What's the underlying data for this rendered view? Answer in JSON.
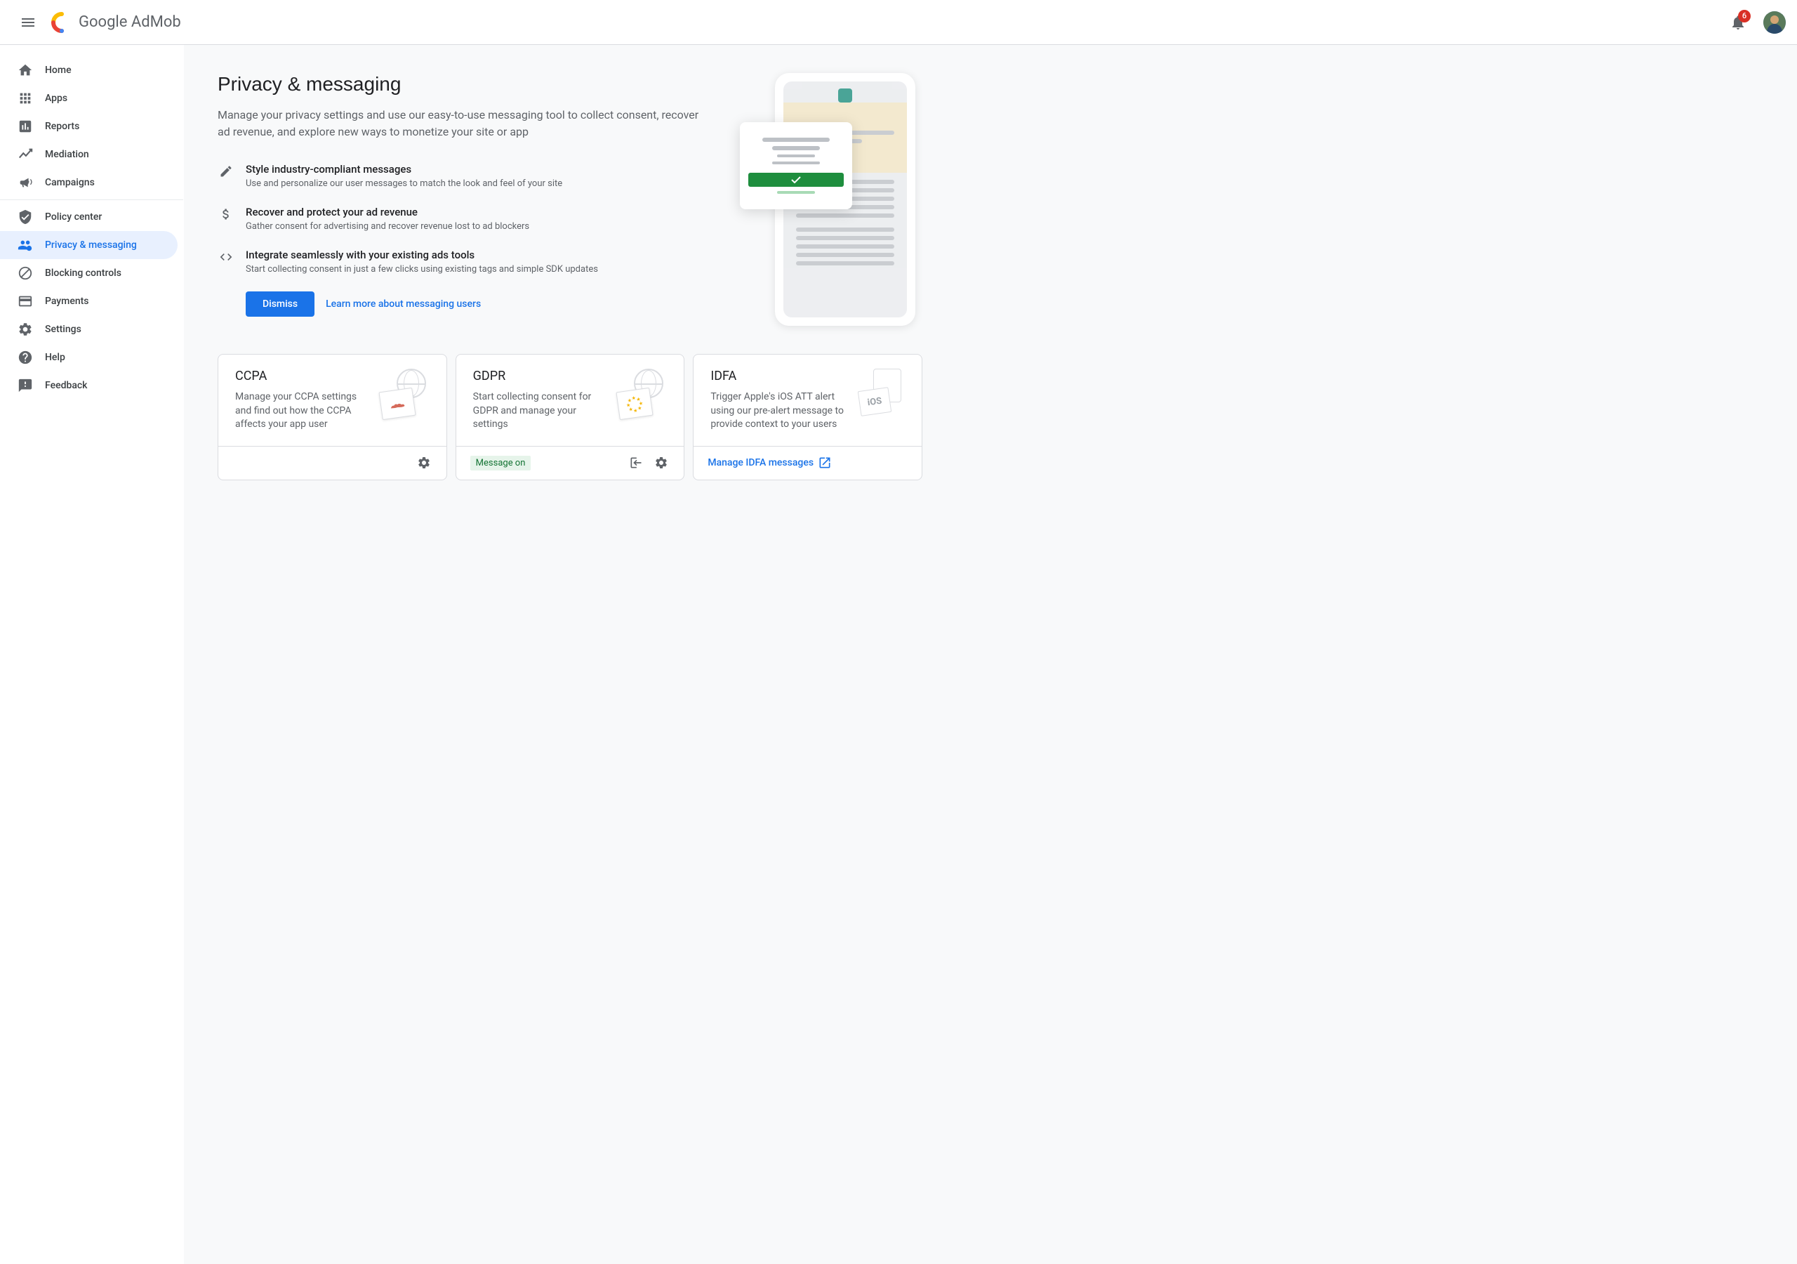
{
  "header": {
    "productName": "Google AdMob",
    "notificationCount": "6"
  },
  "sidebar": {
    "groups": [
      [
        {
          "key": "home",
          "label": "Home",
          "icon": "home"
        },
        {
          "key": "apps",
          "label": "Apps",
          "icon": "apps"
        },
        {
          "key": "reports",
          "label": "Reports",
          "icon": "bar-chart"
        },
        {
          "key": "mediation",
          "label": "Mediation",
          "icon": "trend"
        },
        {
          "key": "campaigns",
          "label": "Campaigns",
          "icon": "megaphone"
        }
      ],
      [
        {
          "key": "policy",
          "label": "Policy center",
          "icon": "shield"
        },
        {
          "key": "privacy",
          "label": "Privacy & messaging",
          "icon": "privacy",
          "active": true
        },
        {
          "key": "blocking",
          "label": "Blocking controls",
          "icon": "block"
        },
        {
          "key": "payments",
          "label": "Payments",
          "icon": "payments"
        },
        {
          "key": "settings",
          "label": "Settings",
          "icon": "gear"
        },
        {
          "key": "help",
          "label": "Help",
          "icon": "help"
        },
        {
          "key": "feedback",
          "label": "Feedback",
          "icon": "feedback"
        }
      ]
    ]
  },
  "hero": {
    "title": "Privacy & messaging",
    "subtitle": "Manage your privacy settings and use our easy-to-use messaging tool to collect consent, recover ad revenue, and explore new ways to monetize your site or app",
    "features": [
      {
        "icon": "pencil",
        "title": "Style industry-compliant messages",
        "desc": "Use and personalize our user messages to match the look and feel of your site"
      },
      {
        "icon": "dollar",
        "title": "Recover and protect your ad revenue",
        "desc": "Gather consent for advertising and recover revenue lost to ad blockers"
      },
      {
        "icon": "code",
        "title": "Integrate seamlessly with your existing ads tools",
        "desc": "Start collecting consent in just a few clicks using existing tags and simple SDK updates"
      }
    ],
    "dismissLabel": "Dismiss",
    "learnMore": "Learn more about messaging users"
  },
  "cards": [
    {
      "key": "ccpa",
      "title": "CCPA",
      "desc": "Manage your CCPA settings and find out how the CCPA affects your app user",
      "footer": {
        "type": "gear"
      }
    },
    {
      "key": "gdpr",
      "title": "GDPR",
      "desc": "Start collecting consent for GDPR and manage your settings",
      "footer": {
        "type": "chip-icons",
        "chip": "Message on"
      }
    },
    {
      "key": "idfa",
      "title": "IDFA",
      "desc": "Trigger Apple's iOS ATT alert using our pre-alert message to provide context to your users",
      "footer": {
        "type": "link",
        "link": "Manage IDFA messages"
      }
    }
  ]
}
